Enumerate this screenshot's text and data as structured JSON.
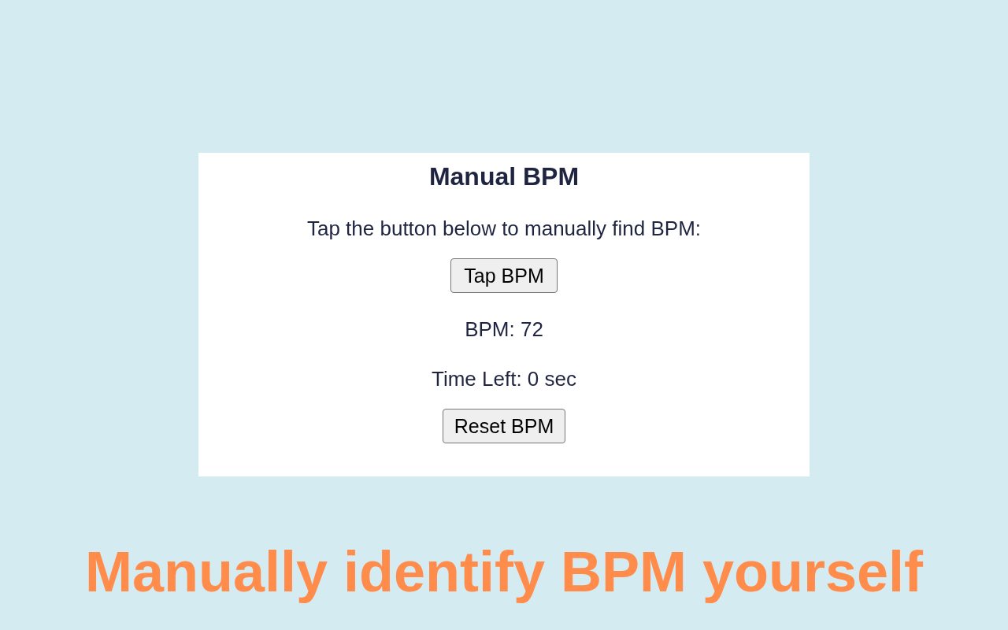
{
  "panel": {
    "title": "Manual BPM",
    "instruction": "Tap the button below to manually find BPM:",
    "tap_button": "Tap BPM",
    "bpm_reading": "BPM: 72",
    "time_left": "Time Left: 0 sec",
    "reset_button": "Reset BPM"
  },
  "caption": "Manually identify BPM yourself"
}
